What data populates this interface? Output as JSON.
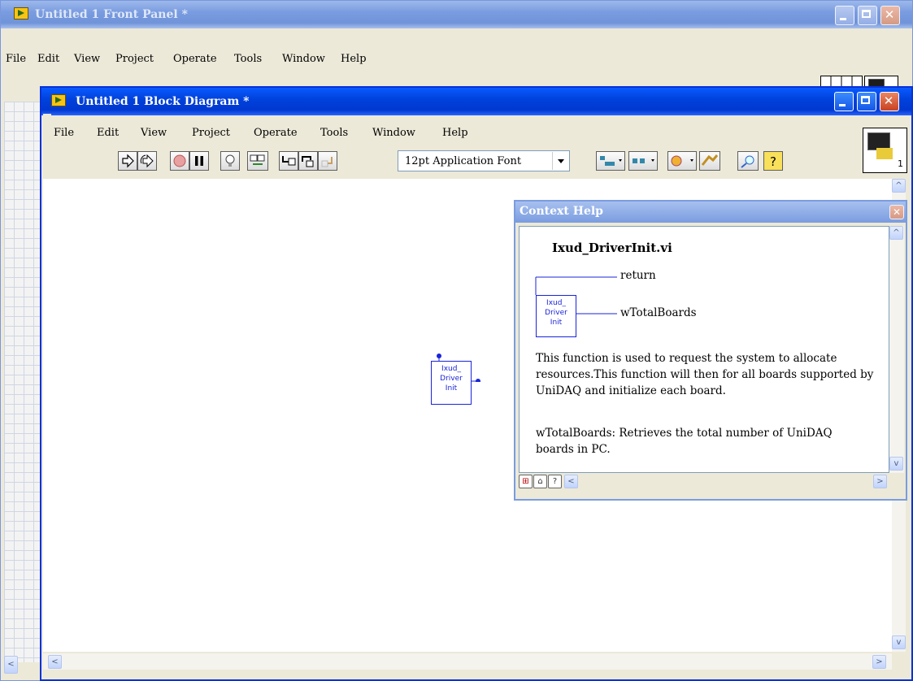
{
  "front_panel": {
    "title": "Untitled 1 Front Panel *",
    "menu": [
      "File",
      "Edit",
      "View",
      "Project",
      "Operate",
      "Tools",
      "Window",
      "Help"
    ]
  },
  "block_diagram": {
    "title": "Untitled 1 Block Diagram *",
    "menu": [
      "File",
      "Edit",
      "View",
      "Project",
      "Operate",
      "Tools",
      "Window",
      "Help"
    ],
    "font_selector": "12pt Application Font",
    "connector_number": "1",
    "node_label": [
      "Ixud_",
      "Driver",
      "Init"
    ]
  },
  "context_help": {
    "title": "Context Help",
    "vi_name": "Ixud_DriverInit.vi",
    "terminal_return": "return",
    "terminal_boards": "wTotalBoards",
    "node_label": [
      "Ixud_",
      "Driver",
      "Init"
    ],
    "description": "This function is used to request the system to allocate resources.This function will then for all boards supported by UniDAQ and initialize each board.",
    "param_help": "wTotalBoards: Retrieves the total number of UniDAQ boards in PC."
  },
  "icons": [
    "labview-app-icon",
    "run-arrow-icon",
    "run-continuously-icon",
    "abort-icon",
    "pause-icon",
    "highlight-execution-bulb-icon",
    "retain-wire-values-icon",
    "step-into-icon",
    "step-over-icon",
    "step-out-icon",
    "align-icon",
    "distribute-icon",
    "reorder-icon",
    "clean-up-icon",
    "search-icon",
    "context-help-icon"
  ],
  "colors": {
    "title_active": "#0042dd",
    "title_inactive": "#7a9ce0",
    "wire_blue": "#1a24d9"
  }
}
